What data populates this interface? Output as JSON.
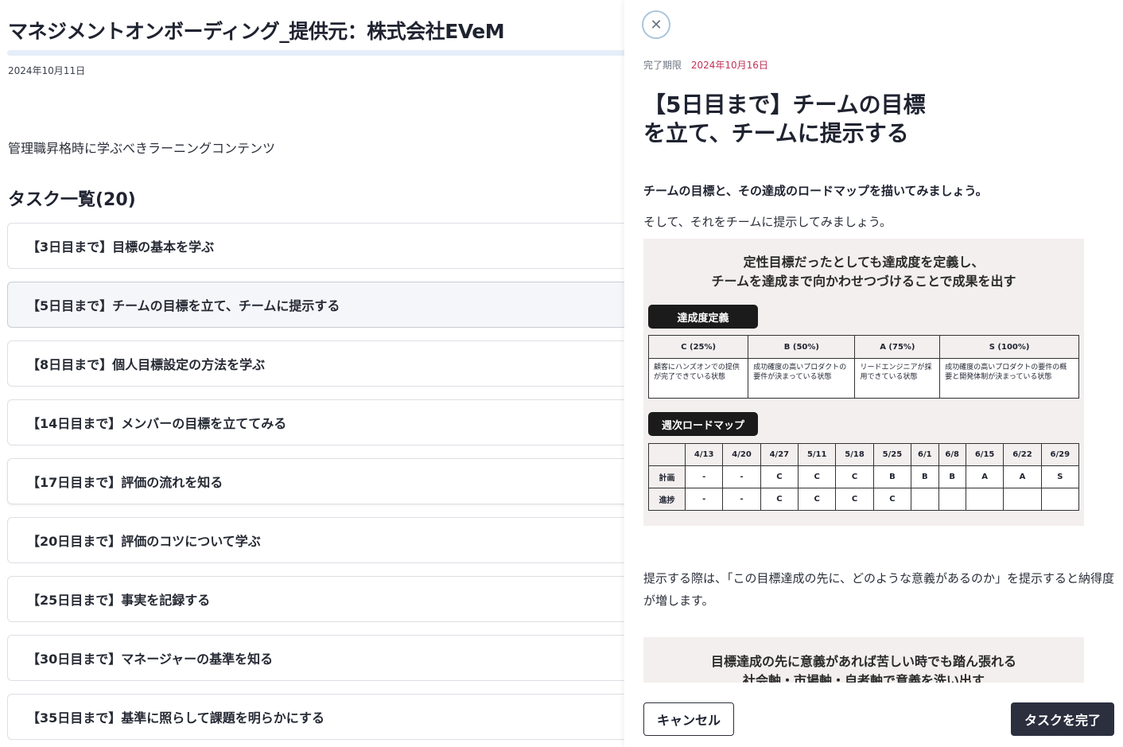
{
  "page": {
    "title": "マネジメントオンボーディング_提供元：株式会社EVeM",
    "date": "2024年10月11日",
    "description": "管理職昇格時に学ぶべきラーニングコンテンツ",
    "task_heading": "タスク一覧(20)"
  },
  "tasks": [
    "【3日目まで】目標の基本を学ぶ",
    "【5日目まで】チームの目標を立て、チームに提示する",
    "【8日目まで】個人目標設定の方法を学ぶ",
    "【14日目まで】メンバーの目標を立ててみる",
    "【17日目まで】評価の流れを知る",
    "【20日目まで】評価のコツについて学ぶ",
    "【25日目まで】事実を記録する",
    "【30日目まで】マネージャーの基準を知る",
    "【35日目まで】基準に照らして課題を明らかにする"
  ],
  "drawer": {
    "close_icon": "close-icon",
    "due_label": "完了期限",
    "due_date": "2024年10月16日",
    "title_line1": "【5日目まで】チームの目標",
    "title_line2": "を立て、チームに提示する",
    "para1": "チームの目標と、その達成のロードマップを描いてみましょう。",
    "para2": "そして、それをチームに提示してみましょう。",
    "para3": "提示する際は、「この目標達成の先に、どのような意義があるのか」を提示すると納得度が増します。",
    "figure1": {
      "heading_line1": "定性目標だったとしても達成度を定義し、",
      "heading_line2": "チームを達成まで向かわせつづけることで成果を出す",
      "section1": "達成度定義",
      "levels": [
        {
          "head": "C (25%)",
          "text": "顧客にハンズオンでの提供が完了できている状態"
        },
        {
          "head": "B (50%)",
          "text": "成功確度の高いプロダクトの要件が決まっている状態"
        },
        {
          "head": "A (75%)",
          "text": "リードエンジニアが採用できている状態"
        },
        {
          "head": "S (100%)",
          "text": "成功確度の高いプロダクトの要件の概要と開発体制が決まっている状態"
        }
      ],
      "section2": "週次ロードマップ",
      "weeks": [
        "4/13",
        "4/20",
        "4/27",
        "5/11",
        "5/18",
        "5/25",
        "6/1",
        "6/8",
        "6/15",
        "6/22",
        "6/29"
      ],
      "plan_label": "計画",
      "plan": [
        "-",
        "-",
        "C",
        "C",
        "C",
        "B",
        "B",
        "B",
        "A",
        "A",
        "S"
      ],
      "progress_label": "進捗",
      "progress": [
        "-",
        "-",
        "C",
        "C",
        "C",
        "C",
        "",
        "",
        "",
        "",
        ""
      ]
    },
    "figure2": {
      "heading_line1": "目標達成の先に意義があれば苦しい時でも踏ん張れる",
      "heading_line2": "社会軸・市場軸・自者軸で意義を洗い出す"
    },
    "cancel_label": "キャンセル",
    "complete_label": "タスクを完了"
  },
  "colors": {
    "due_date": "#c2315a",
    "primary_button": "#2b2f3e",
    "progress_track": "#e5eef8"
  }
}
